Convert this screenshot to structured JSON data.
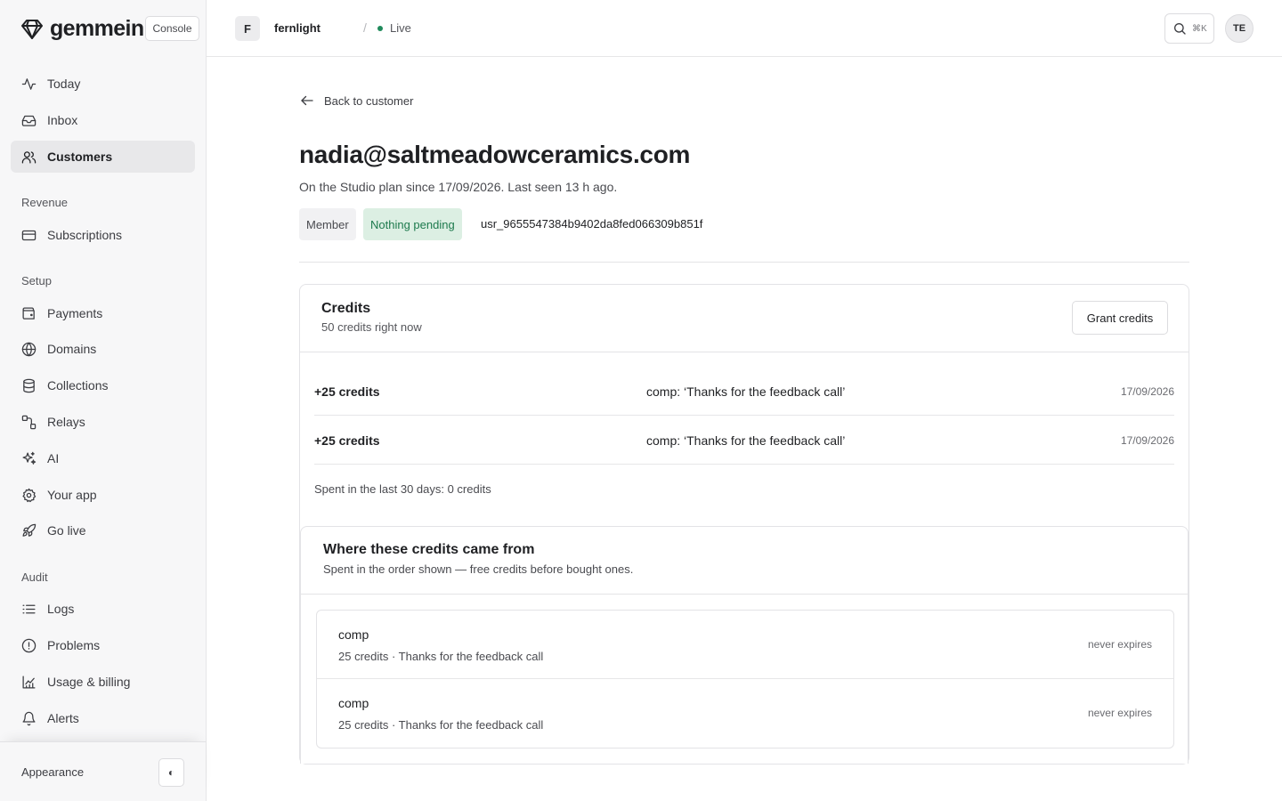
{
  "brand": {
    "name": "gemmein",
    "console_label": "Console"
  },
  "sidebar": {
    "main_items": [
      {
        "label": "Today",
        "icon": "activity-icon"
      },
      {
        "label": "Inbox",
        "icon": "inbox-icon"
      },
      {
        "label": "Customers",
        "icon": "users-icon",
        "active": true
      }
    ],
    "sections": [
      {
        "label": "Revenue",
        "items": [
          {
            "label": "Subscriptions",
            "icon": "credit-card-icon"
          }
        ]
      },
      {
        "label": "Setup",
        "items": [
          {
            "label": "Payments",
            "icon": "wallet-icon"
          },
          {
            "label": "Domains",
            "icon": "globe-icon"
          },
          {
            "label": "Collections",
            "icon": "database-icon"
          },
          {
            "label": "Relays",
            "icon": "route-icon"
          },
          {
            "label": "AI",
            "icon": "sparkles-icon"
          },
          {
            "label": "Your app",
            "icon": "gear-icon"
          },
          {
            "label": "Go live",
            "icon": "rocket-icon"
          }
        ]
      },
      {
        "label": "Audit",
        "items": [
          {
            "label": "Logs",
            "icon": "list-icon"
          },
          {
            "label": "Problems",
            "icon": "alert-circle-icon"
          },
          {
            "label": "Usage & billing",
            "icon": "chart-icon"
          },
          {
            "label": "Alerts",
            "icon": "bell-icon"
          }
        ]
      }
    ],
    "footer": {
      "appearance_label": "Appearance",
      "appearance_toggle": "◐"
    }
  },
  "topbar": {
    "org_initial": "F",
    "org_name": "fernlight",
    "separator": "/",
    "environment": "Live",
    "environment_color": "#1f8a5b",
    "search_shortcut": "⌘K",
    "user_initials": "TE"
  },
  "page": {
    "back_label": "Back to customer",
    "title": "nadia@saltmeadowceramics.com",
    "subtitle": "On the Studio plan since 17/09/2026. Last seen 13 h ago.",
    "badges": {
      "member": "Member",
      "pending": "Nothing pending"
    },
    "user_id": "usr_9655547384b9402da8fed066309b851f"
  },
  "credits": {
    "title": "Credits",
    "subtitle": "50 credits right now",
    "grant_label": "Grant credits",
    "ledger": [
      {
        "amount": "+25 credits",
        "note": "comp: ‘Thanks for the feedback call’",
        "date": "17/09/2026"
      },
      {
        "amount": "+25 credits",
        "note": "comp: ‘Thanks for the feedback call’",
        "date": "17/09/2026"
      }
    ],
    "spent_summary": "Spent in the last 30 days: 0 credits",
    "sources": {
      "title": "Where these credits came from",
      "subtitle": "Spent in the order shown — free credits before bought ones.",
      "items": [
        {
          "kind": "comp",
          "description": "25 credits · Thanks for the feedback call",
          "expiry": "never expires"
        },
        {
          "kind": "comp",
          "description": "25 credits · Thanks for the feedback call",
          "expiry": "never expires"
        }
      ]
    }
  },
  "colors": {
    "accent_green": "#1d7a4d",
    "pending_bg": "#dcefe3",
    "sidebar_bg": "#f7f7f8",
    "active_item_bg": "#e8e8ea"
  }
}
